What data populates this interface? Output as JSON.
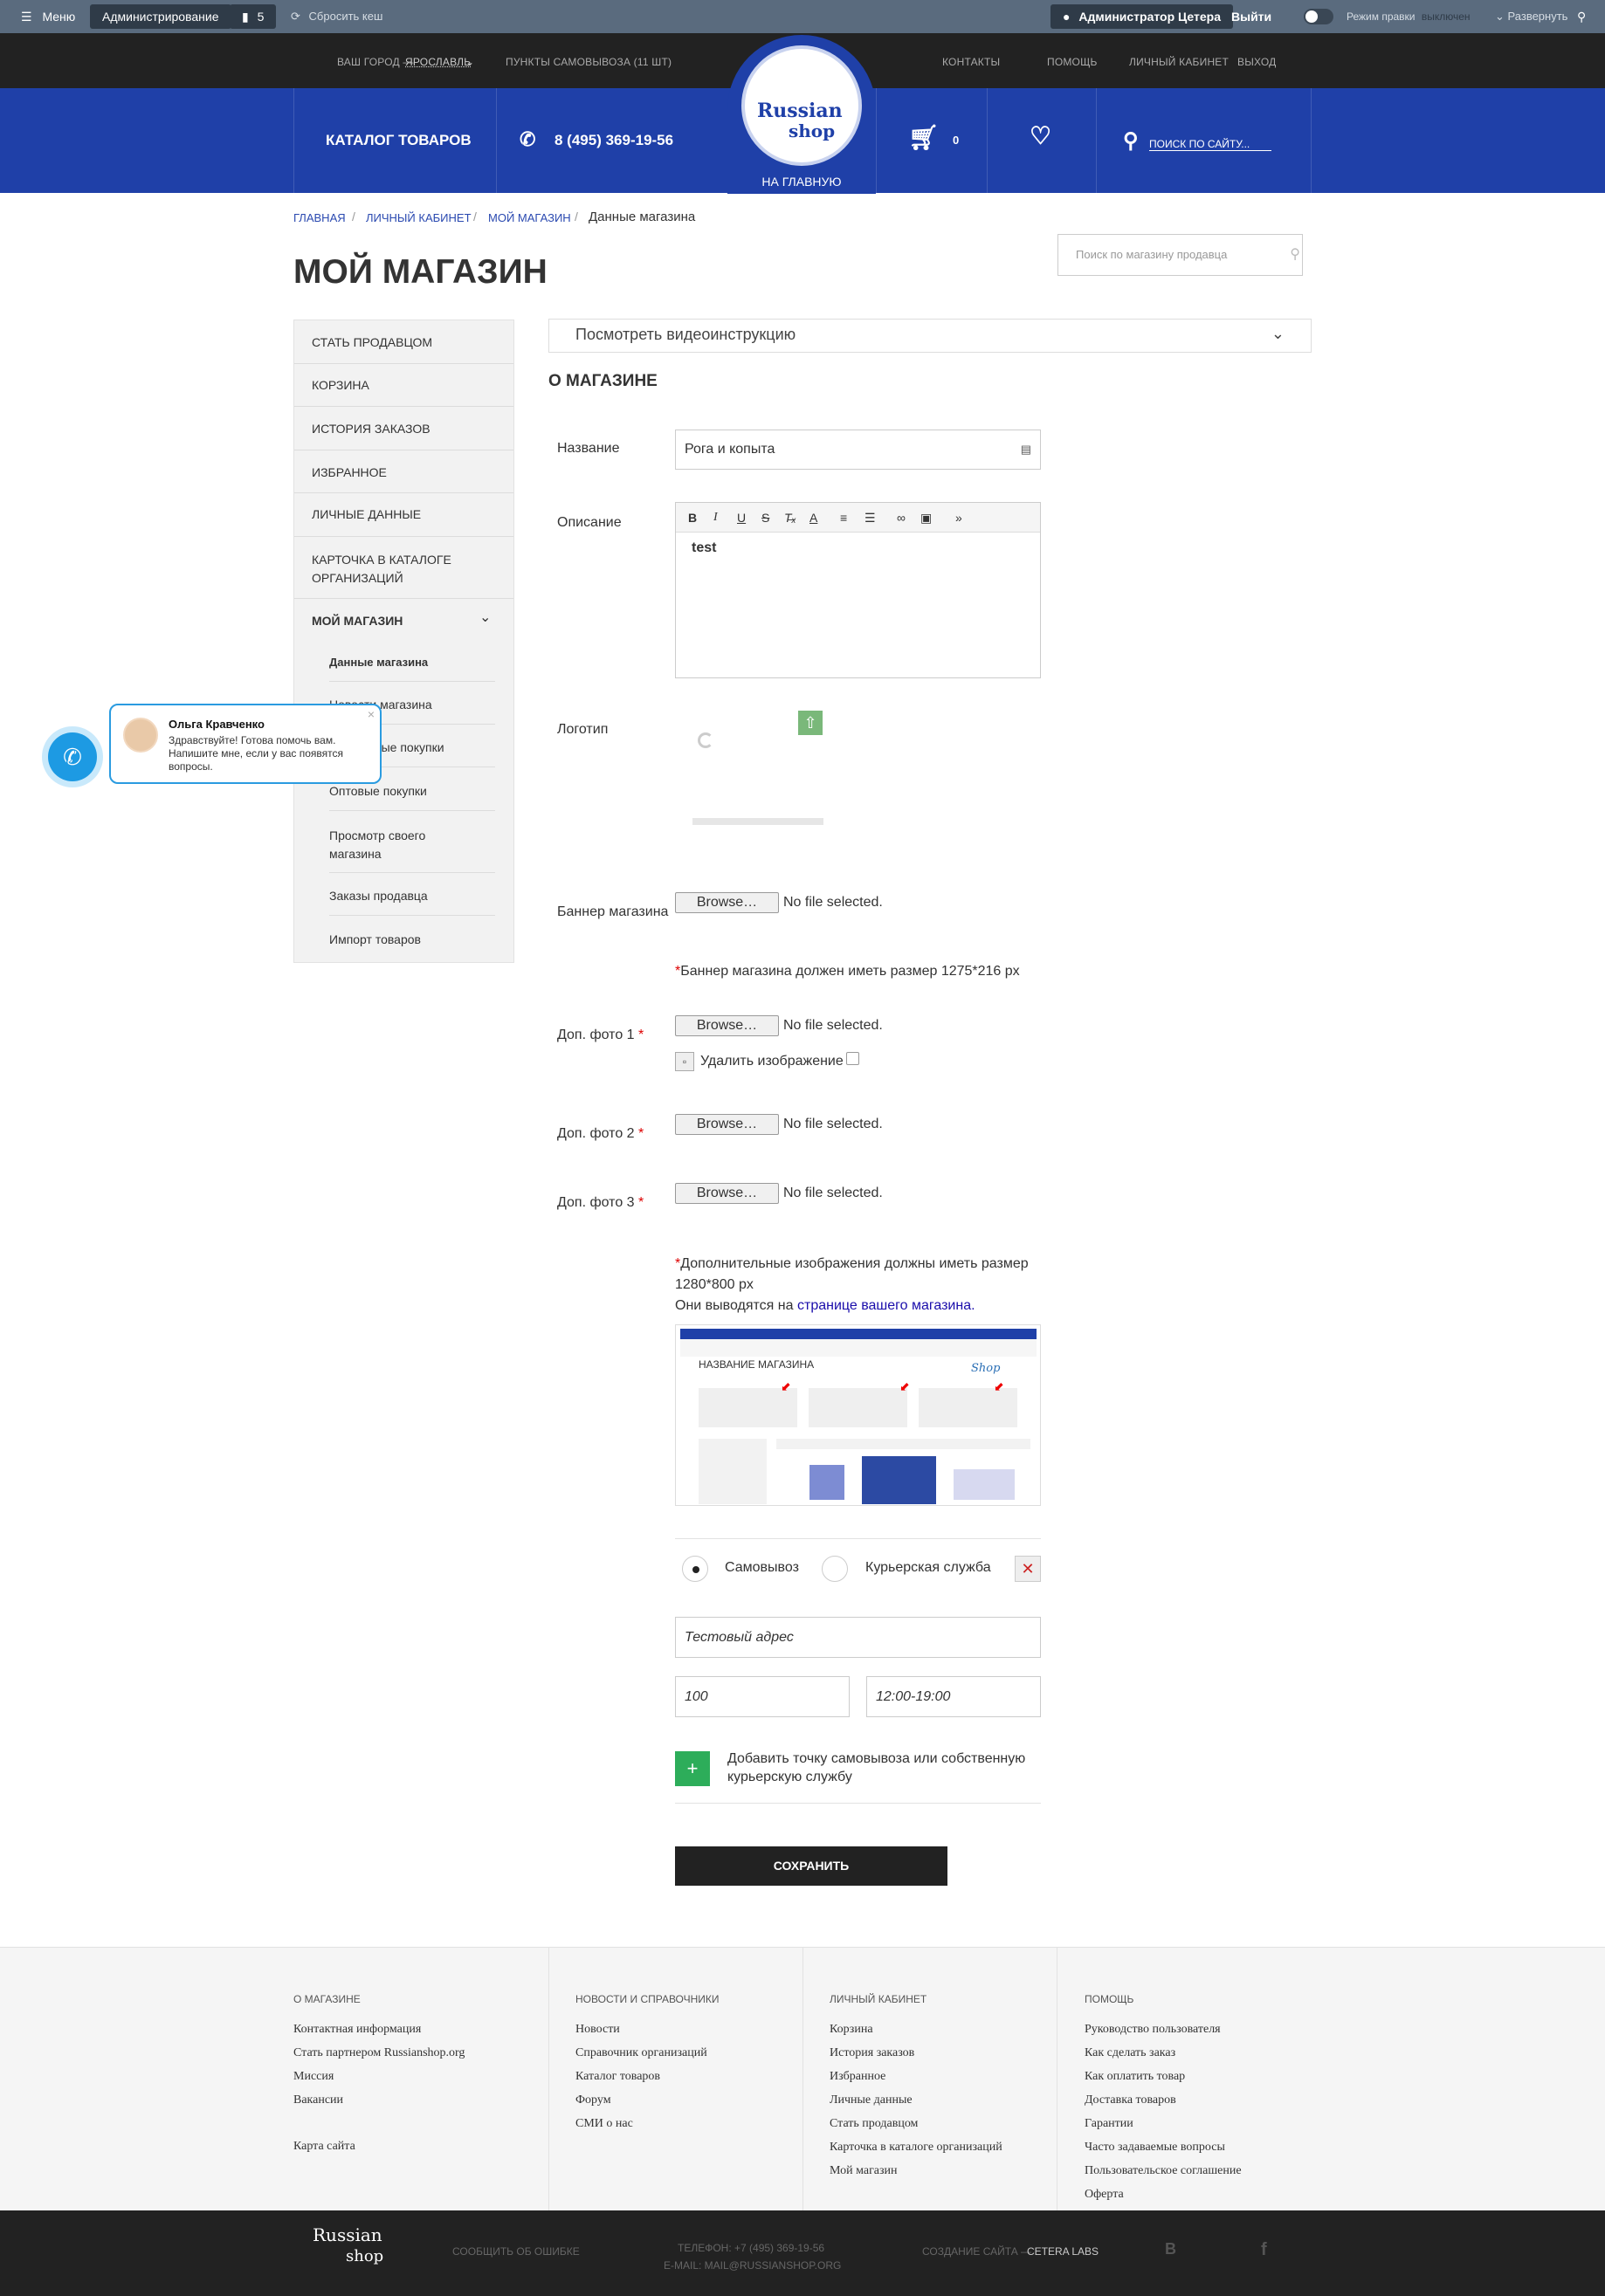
{
  "adminbar": {
    "menu": "Меню",
    "admin": "Администрирование",
    "count": "5",
    "clear_cache": "Сбросить кеш",
    "user": "Администратор Цетера",
    "logout": "Выйти",
    "edit_mode": "Режим правки",
    "edit_state": "выключен",
    "expand": "Развернуть"
  },
  "topstrip": {
    "city_label": "Ваш город —",
    "city": "Ярославль",
    "pickup_points": "Пункты самовывоза (11 шт)",
    "contacts": "Контакты",
    "help": "Помощь",
    "cabinet": "Личный кабинет",
    "exit": "Выход"
  },
  "header": {
    "catalog": "КАТАЛОГ ТОВАРОВ",
    "phone": "8 (495) 369-19-56",
    "logo_line1": "Russian",
    "logo_line2": "shop",
    "home_caption": "НА ГЛАВНУЮ",
    "cart_count": "0",
    "search_placeholder": "ПОИСК ПО САЙТУ..."
  },
  "breadcrumb": {
    "home": "Главная",
    "cabinet": "Личный кабинет",
    "shop": "Мой магазин",
    "current": "Данные магазина"
  },
  "page_title": "МОЙ МАГАЗИН",
  "shop_search_placeholder": "Поиск по магазину продавца",
  "sidebar": {
    "items": [
      "Стать продавцом",
      "Корзина",
      "История заказов",
      "Избранное",
      "Личные данные",
      "Карточка в каталоге организаций",
      "Мой магазин"
    ],
    "subitems": [
      "Данные магазина",
      "Новости магазина",
      "Закупочные покупки",
      "Оптовые покупки",
      "Просмотр своего магазина",
      "Заказы продавца",
      "Импорт товаров"
    ]
  },
  "main": {
    "video": "Посмотреть видеоинструкцию",
    "section": "О МАГАЗИНЕ",
    "name_label": "Название",
    "name_value": "Рога и копыта",
    "desc_label": "Описание",
    "desc_value": "test",
    "logo_label": "Логотип",
    "banner_label": "Баннер магазина",
    "browse": "Browse…",
    "no_file": "No file selected.",
    "banner_note": "Баннер магазина должен иметь размер 1275*216 px",
    "photo1_label": "Доп. фото 1",
    "photo2_label": "Доп. фото 2",
    "photo3_label": "Доп. фото 3",
    "delete_image": "Удалить изображение",
    "photos_note_1": "Дополнительные изображения должны иметь размер",
    "photos_note_2": "1280*800 px",
    "photos_note_3": "Они выводятся на",
    "photos_note_link": "странице вашего магазина.",
    "preview_title": "НАЗВАНИЕ МАГАЗИНА",
    "pickup": "Самовывоз",
    "courier": "Курьерская служба",
    "address": "Тестовый адрес",
    "price": "100",
    "hours": "12:00-19:00",
    "add_point": "Добавить точку самовывоза или собственную курьерскую службу",
    "save": "СОХРАНИТЬ"
  },
  "chat": {
    "name": "Ольга Кравченко",
    "message": "Здравствуйте! Готова помочь вам. Напишите мне, если у вас появятся вопросы."
  },
  "footer": {
    "col1_title": "О магазине",
    "col1": [
      "Контактная информация",
      "Стать партнером Russianshop.org",
      "Миссия",
      "Вакансии",
      "Карта сайта"
    ],
    "col2_title": "Новости и справочники",
    "col2": [
      "Новости",
      "Справочник организаций",
      "Каталог товаров",
      "Форум",
      "СМИ о нас"
    ],
    "col3_title": "Личный кабинет",
    "col3": [
      "Корзина",
      "История заказов",
      "Избранное",
      "Личные данные",
      "Стать продавцом",
      "Карточка в каталоге организаций",
      "Мой магазин"
    ],
    "col4_title": "Помощь",
    "col4": [
      "Руководство пользователя",
      "Как сделать заказ",
      "Как оплатить товар",
      "Доставка товаров",
      "Гарантии",
      "Часто задаваемые вопросы",
      "Пользовательское соглашение",
      "Оферта"
    ]
  },
  "bottom": {
    "report": "Сообщить об ошибке",
    "phone": "Телефон: +7 (495) 369-19-56",
    "email": "E-mail: mail@russianshop.org",
    "created": "Создание сайта —",
    "created_by": "CETERA LABS"
  },
  "colors": {
    "brand_blue": "#1f40a8",
    "dark": "#222222",
    "admin_bar": "#5a6b7e"
  }
}
